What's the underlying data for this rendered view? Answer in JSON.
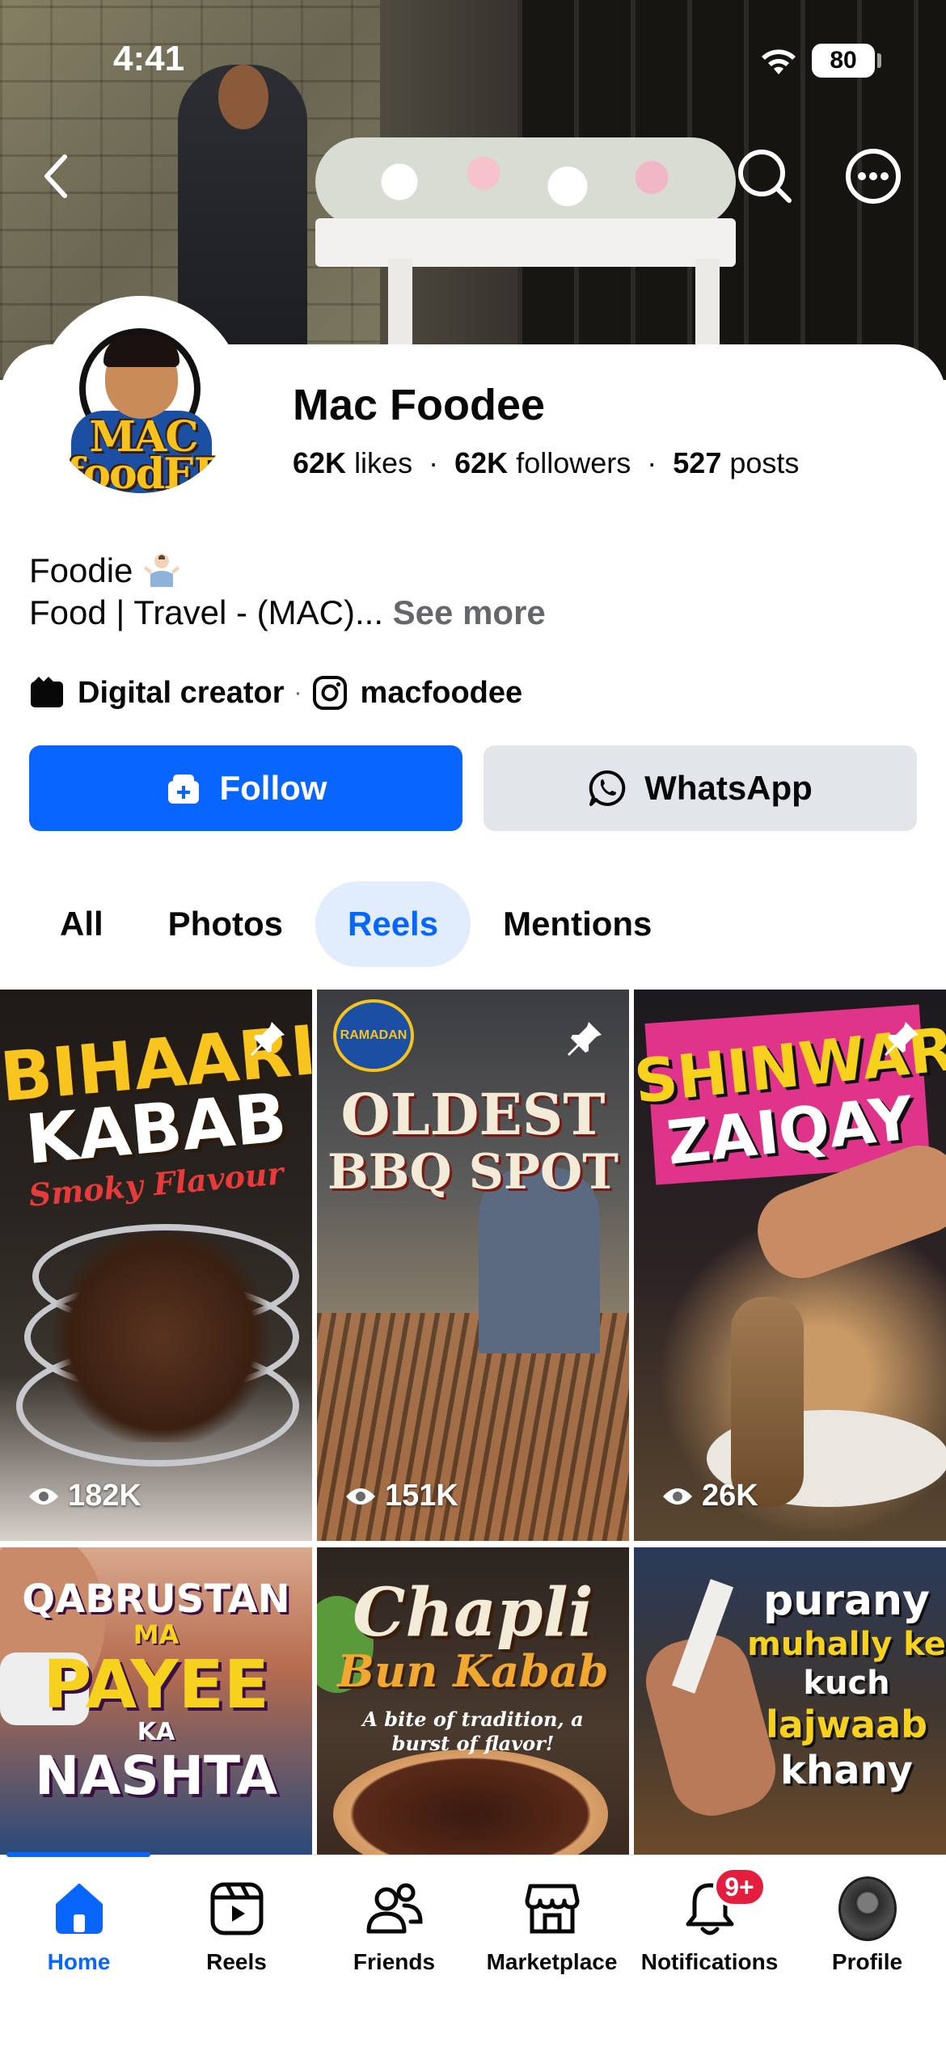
{
  "status_bar": {
    "time": "4:41",
    "battery": "80"
  },
  "page": {
    "name": "Mac Foodee",
    "avatar_text": "MAC foodEE",
    "stats": {
      "likes_value": "62K",
      "likes_label": "likes",
      "followers_value": "62K",
      "followers_label": "followers",
      "posts_value": "527",
      "posts_label": "posts"
    },
    "bio_line1": "Foodie",
    "bio_line2": "Food | Travel - (MAC)...",
    "see_more": "See more",
    "category": "Digital creator",
    "instagram": "macfoodee"
  },
  "actions": {
    "follow_label": "Follow",
    "whatsapp_label": "WhatsApp"
  },
  "tabs": [
    {
      "label": "All",
      "active": false
    },
    {
      "label": "Photos",
      "active": false
    },
    {
      "label": "Reels",
      "active": true
    },
    {
      "label": "Mentions",
      "active": false
    }
  ],
  "reels": [
    {
      "title_line1": "BIHAARI",
      "title_line2": "KABAB",
      "subtitle": "Smoky Flavour",
      "views": "182K",
      "pinned": true
    },
    {
      "title_line1": "OLDEST",
      "title_line2": "BBQ SPOT",
      "badge": "RAMADAN",
      "views": "151K",
      "pinned": true
    },
    {
      "title_line1": "SHINWARI",
      "title_line2": "ZAIQAY",
      "views": "26K",
      "pinned": true
    },
    {
      "title_line1": "QABRUSTAN",
      "title_line2": "MA",
      "title_line3": "PAYEE",
      "title_line4": "KA",
      "title_line5": "NASHTA"
    },
    {
      "title_line1": "Chapli",
      "title_line2": "Bun Kabab",
      "subtitle": "A bite of tradition, a burst of flavor!"
    },
    {
      "title_line1": "purany",
      "title_line2": "muhally ke",
      "title_line3": "kuch",
      "title_line4": "lajwaab",
      "title_line5": "khany"
    }
  ],
  "bottom_nav": {
    "items": [
      {
        "label": "Home",
        "icon": "home-icon",
        "active": true
      },
      {
        "label": "Reels",
        "icon": "reels-icon"
      },
      {
        "label": "Friends",
        "icon": "friends-icon"
      },
      {
        "label": "Marketplace",
        "icon": "marketplace-icon"
      },
      {
        "label": "Notifications",
        "icon": "bell-icon",
        "badge": "9+"
      },
      {
        "label": "Profile",
        "icon": "profile-avatar"
      }
    ]
  },
  "colors": {
    "accent": "#0866ff",
    "tab_active_bg": "#e1ecfd",
    "badge_red": "#e41e3f",
    "secondary_button": "#e2e5e9"
  }
}
